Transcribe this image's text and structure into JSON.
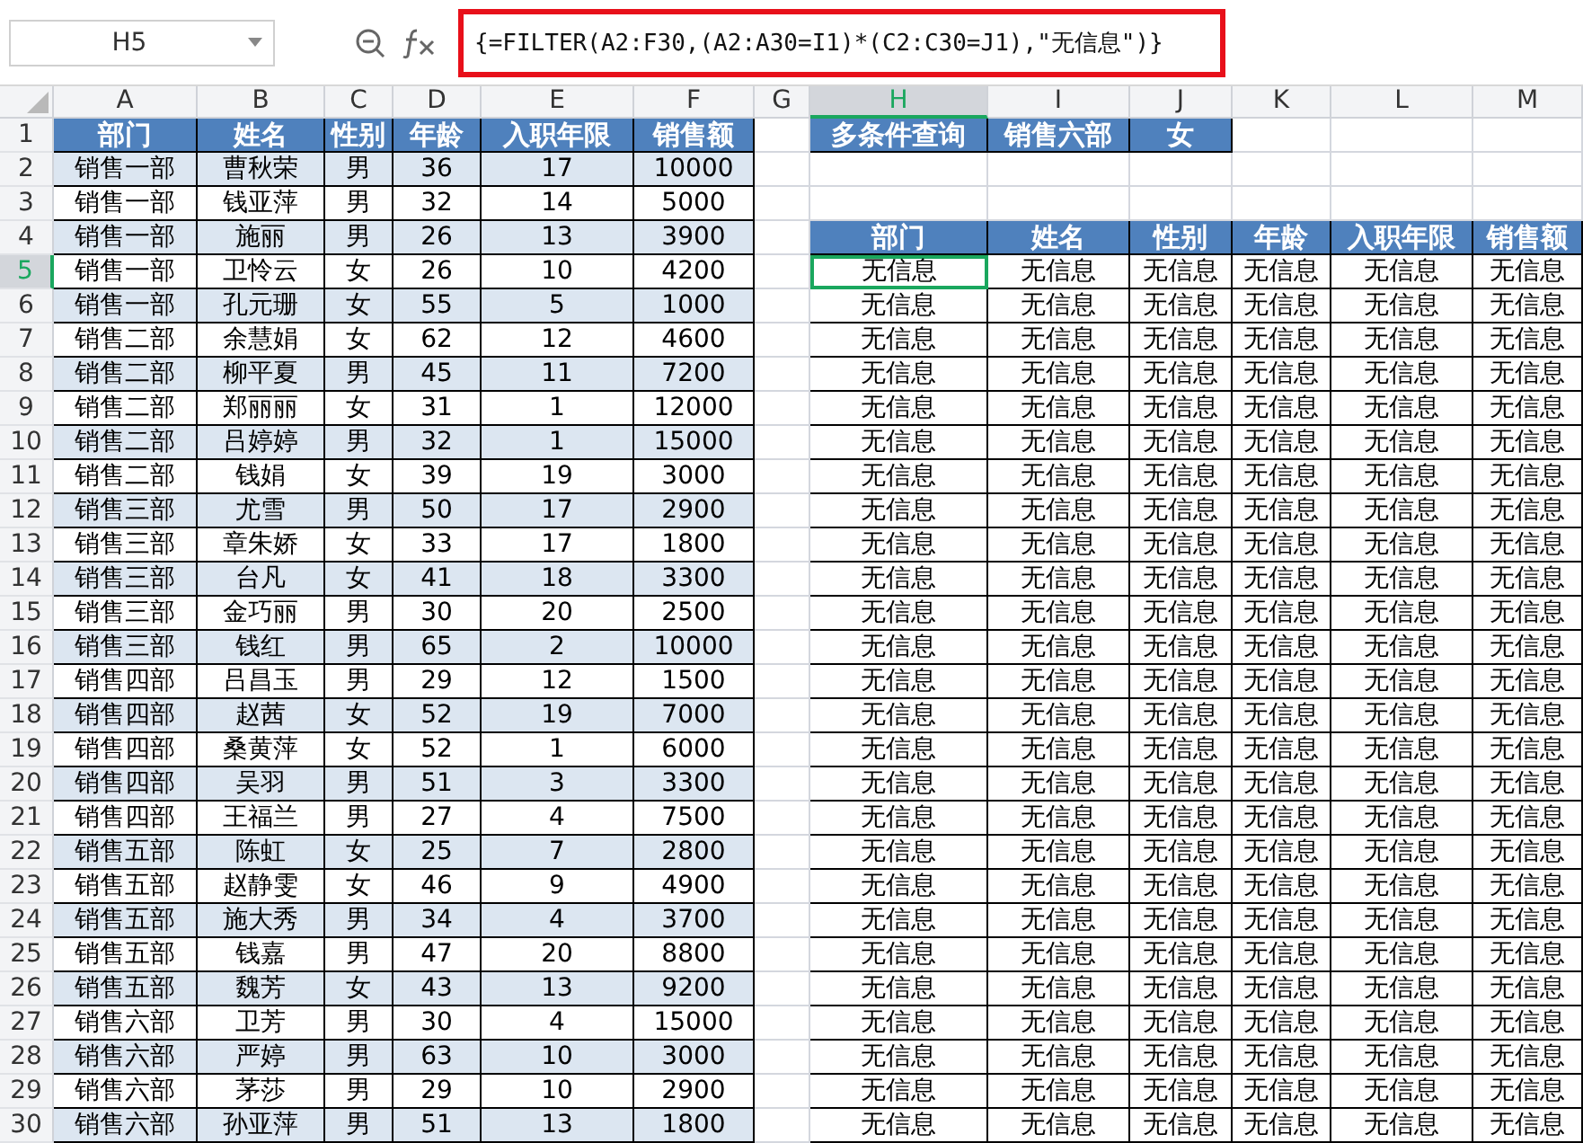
{
  "name_box": "H5",
  "formula": "{=FILTER(A2:F30,(A2:A30=I1)*(C2:C30=J1),\"无信息\")}",
  "column_headers": [
    {
      "label": "A",
      "selected": false
    },
    {
      "label": "B",
      "selected": false
    },
    {
      "label": "C",
      "selected": false
    },
    {
      "label": "D",
      "selected": false
    },
    {
      "label": "E",
      "selected": false
    },
    {
      "label": "F",
      "selected": false
    },
    {
      "label": "G",
      "selected": false
    },
    {
      "label": "H",
      "selected": true
    },
    {
      "label": "I",
      "selected": false
    },
    {
      "label": "J",
      "selected": false
    },
    {
      "label": "K",
      "selected": false
    },
    {
      "label": "L",
      "selected": false
    },
    {
      "label": "M",
      "selected": false
    }
  ],
  "row_headers": [
    {
      "label": "1",
      "selected": false
    },
    {
      "label": "2",
      "selected": false
    },
    {
      "label": "3",
      "selected": false
    },
    {
      "label": "4",
      "selected": false
    },
    {
      "label": "5",
      "selected": true
    },
    {
      "label": "6",
      "selected": false
    },
    {
      "label": "7",
      "selected": false
    },
    {
      "label": "8",
      "selected": false
    },
    {
      "label": "9",
      "selected": false
    },
    {
      "label": "10",
      "selected": false
    },
    {
      "label": "11",
      "selected": false
    },
    {
      "label": "12",
      "selected": false
    },
    {
      "label": "13",
      "selected": false
    },
    {
      "label": "14",
      "selected": false
    },
    {
      "label": "15",
      "selected": false
    },
    {
      "label": "16",
      "selected": false
    },
    {
      "label": "17",
      "selected": false
    },
    {
      "label": "18",
      "selected": false
    },
    {
      "label": "19",
      "selected": false
    },
    {
      "label": "20",
      "selected": false
    },
    {
      "label": "21",
      "selected": false
    },
    {
      "label": "22",
      "selected": false
    },
    {
      "label": "23",
      "selected": false
    },
    {
      "label": "24",
      "selected": false
    },
    {
      "label": "25",
      "selected": false
    },
    {
      "label": "26",
      "selected": false
    },
    {
      "label": "27",
      "selected": false
    },
    {
      "label": "28",
      "selected": false
    },
    {
      "label": "29",
      "selected": false
    },
    {
      "label": "30",
      "selected": false
    }
  ],
  "source_table": {
    "columns": [
      "部门",
      "姓名",
      "性别",
      "年龄",
      "入职年限",
      "销售额"
    ],
    "rows": [
      [
        "销售一部",
        "曹秋荣",
        "男",
        "36",
        "17",
        "10000"
      ],
      [
        "销售一部",
        "钱亚萍",
        "男",
        "32",
        "14",
        "5000"
      ],
      [
        "销售一部",
        "施丽",
        "男",
        "26",
        "13",
        "3900"
      ],
      [
        "销售一部",
        "卫怜云",
        "女",
        "26",
        "10",
        "4200"
      ],
      [
        "销售一部",
        "孔元珊",
        "女",
        "55",
        "5",
        "1000"
      ],
      [
        "销售二部",
        "余慧娟",
        "女",
        "62",
        "12",
        "4600"
      ],
      [
        "销售二部",
        "柳平夏",
        "男",
        "45",
        "11",
        "7200"
      ],
      [
        "销售二部",
        "郑丽丽",
        "女",
        "31",
        "1",
        "12000"
      ],
      [
        "销售二部",
        "吕婷婷",
        "男",
        "32",
        "1",
        "15000"
      ],
      [
        "销售二部",
        "钱娟",
        "女",
        "39",
        "19",
        "3000"
      ],
      [
        "销售三部",
        "尤雪",
        "男",
        "50",
        "17",
        "2900"
      ],
      [
        "销售三部",
        "章朱娇",
        "女",
        "33",
        "17",
        "1800"
      ],
      [
        "销售三部",
        "台凡",
        "女",
        "41",
        "18",
        "3300"
      ],
      [
        "销售三部",
        "金巧丽",
        "男",
        "30",
        "20",
        "2500"
      ],
      [
        "销售三部",
        "钱红",
        "男",
        "65",
        "2",
        "10000"
      ],
      [
        "销售四部",
        "吕昌玉",
        "男",
        "29",
        "12",
        "1500"
      ],
      [
        "销售四部",
        "赵茜",
        "女",
        "52",
        "19",
        "7000"
      ],
      [
        "销售四部",
        "桑黄萍",
        "女",
        "52",
        "1",
        "6000"
      ],
      [
        "销售四部",
        "吴羽",
        "男",
        "51",
        "3",
        "3300"
      ],
      [
        "销售四部",
        "王福兰",
        "男",
        "27",
        "4",
        "7500"
      ],
      [
        "销售五部",
        "陈虹",
        "女",
        "25",
        "7",
        "2800"
      ],
      [
        "销售五部",
        "赵静雯",
        "女",
        "46",
        "9",
        "4900"
      ],
      [
        "销售五部",
        "施大秀",
        "男",
        "34",
        "4",
        "3700"
      ],
      [
        "销售五部",
        "钱嘉",
        "男",
        "47",
        "20",
        "8800"
      ],
      [
        "销售五部",
        "魏芳",
        "女",
        "43",
        "13",
        "9200"
      ],
      [
        "销售六部",
        "卫芳",
        "男",
        "30",
        "4",
        "15000"
      ],
      [
        "销售六部",
        "严婷",
        "男",
        "63",
        "10",
        "3000"
      ],
      [
        "销售六部",
        "茅莎",
        "男",
        "29",
        "10",
        "2900"
      ],
      [
        "销售六部",
        "孙亚萍",
        "男",
        "51",
        "13",
        "1800"
      ]
    ]
  },
  "query": [
    "多条件查询",
    "销售六部",
    "女"
  ],
  "result_table": {
    "columns": [
      "部门",
      "姓名",
      "性别",
      "年龄",
      "入职年限",
      "销售额"
    ],
    "rows": [
      [
        "无信息",
        "无信息",
        "无信息",
        "无信息",
        "无信息",
        "无信息"
      ],
      [
        "无信息",
        "无信息",
        "无信息",
        "无信息",
        "无信息",
        "无信息"
      ],
      [
        "无信息",
        "无信息",
        "无信息",
        "无信息",
        "无信息",
        "无信息"
      ],
      [
        "无信息",
        "无信息",
        "无信息",
        "无信息",
        "无信息",
        "无信息"
      ],
      [
        "无信息",
        "无信息",
        "无信息",
        "无信息",
        "无信息",
        "无信息"
      ],
      [
        "无信息",
        "无信息",
        "无信息",
        "无信息",
        "无信息",
        "无信息"
      ],
      [
        "无信息",
        "无信息",
        "无信息",
        "无信息",
        "无信息",
        "无信息"
      ],
      [
        "无信息",
        "无信息",
        "无信息",
        "无信息",
        "无信息",
        "无信息"
      ],
      [
        "无信息",
        "无信息",
        "无信息",
        "无信息",
        "无信息",
        "无信息"
      ],
      [
        "无信息",
        "无信息",
        "无信息",
        "无信息",
        "无信息",
        "无信息"
      ],
      [
        "无信息",
        "无信息",
        "无信息",
        "无信息",
        "无信息",
        "无信息"
      ],
      [
        "无信息",
        "无信息",
        "无信息",
        "无信息",
        "无信息",
        "无信息"
      ],
      [
        "无信息",
        "无信息",
        "无信息",
        "无信息",
        "无信息",
        "无信息"
      ],
      [
        "无信息",
        "无信息",
        "无信息",
        "无信息",
        "无信息",
        "无信息"
      ],
      [
        "无信息",
        "无信息",
        "无信息",
        "无信息",
        "无信息",
        "无信息"
      ],
      [
        "无信息",
        "无信息",
        "无信息",
        "无信息",
        "无信息",
        "无信息"
      ],
      [
        "无信息",
        "无信息",
        "无信息",
        "无信息",
        "无信息",
        "无信息"
      ],
      [
        "无信息",
        "无信息",
        "无信息",
        "无信息",
        "无信息",
        "无信息"
      ],
      [
        "无信息",
        "无信息",
        "无信息",
        "无信息",
        "无信息",
        "无信息"
      ],
      [
        "无信息",
        "无信息",
        "无信息",
        "无信息",
        "无信息",
        "无信息"
      ],
      [
        "无信息",
        "无信息",
        "无信息",
        "无信息",
        "无信息",
        "无信息"
      ],
      [
        "无信息",
        "无信息",
        "无信息",
        "无信息",
        "无信息",
        "无信息"
      ],
      [
        "无信息",
        "无信息",
        "无信息",
        "无信息",
        "无信息",
        "无信息"
      ],
      [
        "无信息",
        "无信息",
        "无信息",
        "无信息",
        "无信息",
        "无信息"
      ],
      [
        "无信息",
        "无信息",
        "无信息",
        "无信息",
        "无信息",
        "无信息"
      ],
      [
        "无信息",
        "无信息",
        "无信息",
        "无信息",
        "无信息",
        "无信息"
      ]
    ]
  }
}
